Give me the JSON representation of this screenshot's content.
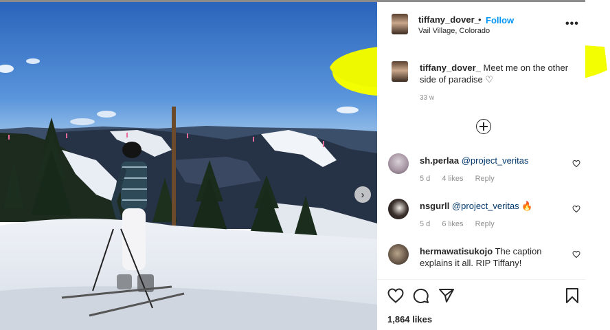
{
  "post": {
    "username": "tiffany_dover_",
    "separator": "•",
    "follow_label": "Follow",
    "location": "Vail Village, Colorado",
    "more_label": "•••",
    "caption": "Meet me on the other side of paradise ♡",
    "caption_time": "33 w",
    "likes": "1,864 likes"
  },
  "comments": [
    {
      "username": "sh.perlaa",
      "text": "@project_veritas",
      "time": "5 d",
      "likes": "4 likes",
      "reply": "Reply"
    },
    {
      "username": "nsgurll",
      "text": "@project_veritas 🔥",
      "time": "5 d",
      "likes": "6 likes",
      "reply": "Reply"
    },
    {
      "username": "hermawatisukojo",
      "text": "The caption explains it all. RIP Tiffany!"
    }
  ],
  "colors": {
    "highlight": "#f3ff00",
    "follow": "#0095f6",
    "sky": "#2f6fc4"
  },
  "icons": [
    "chevron-right-icon",
    "more-icon",
    "add-comment-icon",
    "heart-icon",
    "comment-icon",
    "share-icon",
    "bookmark-icon"
  ]
}
